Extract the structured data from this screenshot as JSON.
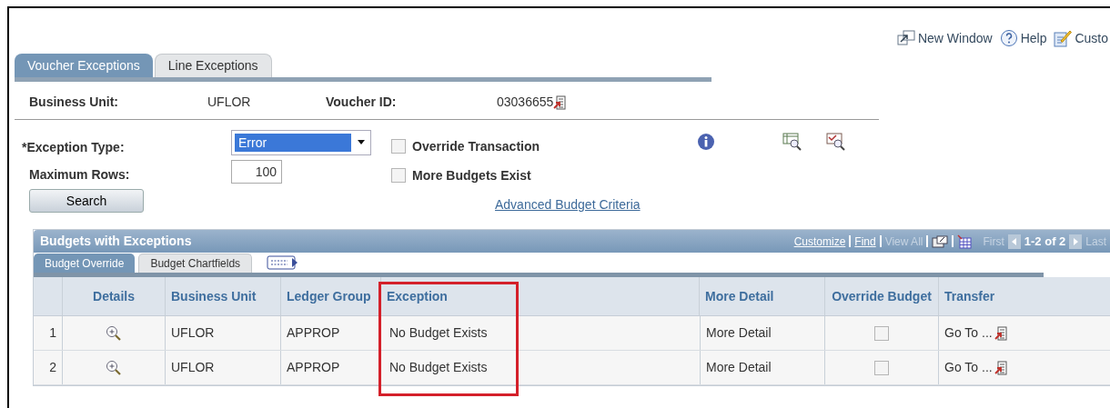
{
  "header_links": [
    {
      "kind": "window",
      "label": "New Window"
    },
    {
      "kind": "help",
      "label": "Help"
    },
    {
      "kind": "customize",
      "label": "Custo"
    }
  ],
  "tabs": [
    {
      "label": "Voucher Exceptions",
      "selected": true
    },
    {
      "label": "Line Exceptions",
      "selected": false
    }
  ],
  "business_unit": {
    "label": "Business Unit:",
    "value": "UFLOR"
  },
  "voucher_id": {
    "label": "Voucher ID:",
    "value": "03036655"
  },
  "exception_type": {
    "label": "*Exception Type:",
    "value": "Error"
  },
  "maximum_rows": {
    "label": "Maximum Rows:",
    "value": "100"
  },
  "checkboxes": [
    {
      "label": "Override Transaction",
      "checked": false
    },
    {
      "label": "More Budgets Exist",
      "checked": false
    }
  ],
  "search_button": "Search",
  "advanced_link": "Advanced Budget Criteria",
  "grid": {
    "title": "Budgets with Exceptions",
    "nav": {
      "customize": "Customize",
      "find": "Find",
      "view_all": "View All",
      "first": "First",
      "range": "1-2 of 2",
      "last": "Last"
    },
    "tabs": [
      {
        "label": "Budget Override",
        "selected": true
      },
      {
        "label": "Budget Chartfields",
        "selected": false
      }
    ],
    "columns": [
      {
        "label": "Details",
        "highlighted": false
      },
      {
        "label": "Business Unit",
        "highlighted": false
      },
      {
        "label": "Ledger Group",
        "highlighted": false
      },
      {
        "label": "Exception",
        "highlighted": true
      },
      {
        "label": "More Detail",
        "highlighted": false
      },
      {
        "label": "Override Budget",
        "highlighted": false
      },
      {
        "label": "Transfer",
        "highlighted": false
      }
    ],
    "rows": [
      {
        "num": "1",
        "business_unit": "UFLOR",
        "ledger_group": "APPROP",
        "exception": "No Budget Exists",
        "more_detail": "More Detail",
        "override": false,
        "transfer": "Go To ..."
      },
      {
        "num": "2",
        "business_unit": "UFLOR",
        "ledger_group": "APPROP",
        "exception": "No Budget Exists",
        "more_detail": "More Detail",
        "override": false,
        "transfer": "Go To ..."
      }
    ]
  }
}
